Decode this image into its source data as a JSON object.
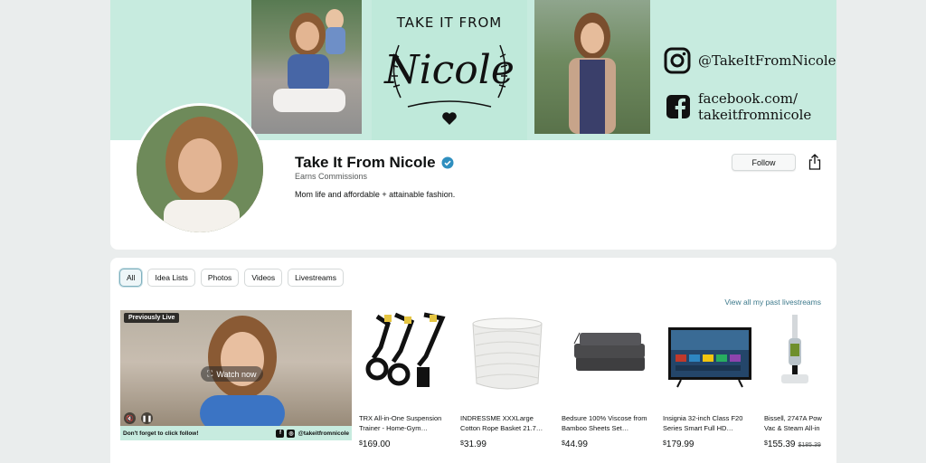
{
  "profile": {
    "name": "Take It From Nicole",
    "earns": "Earns Commissions",
    "bio": "Mom life and affordable + attainable fashion.",
    "follow_label": "Follow",
    "banner": {
      "logo_top_text": "TAKE IT FROM",
      "logo_script_text": "Nicole",
      "instagram_handle": "@TakeItFromNicole",
      "facebook_line1": "facebook.com/",
      "facebook_line2": "takeitfromnicole",
      "bg_color": "#c7ebdf"
    }
  },
  "filters": [
    {
      "label": "All",
      "active": true
    },
    {
      "label": "Idea Lists",
      "active": false
    },
    {
      "label": "Photos",
      "active": false
    },
    {
      "label": "Videos",
      "active": false
    },
    {
      "label": "Livestreams",
      "active": false
    }
  ],
  "view_all_label": "View all my past livestreams",
  "livestream": {
    "badge": "Previously Live",
    "watch_label": "Watch now",
    "cta_text": "Don't forget to click follow!",
    "handle": "@takeitfromnicole"
  },
  "products": [
    {
      "title": "TRX All-in-One Suspension Trainer - Home-Gym…",
      "price_symbol": "$",
      "price": "169.00",
      "was": ""
    },
    {
      "title": "INDRESSME XXXLarge Cotton Rope Basket 21.7…",
      "price_symbol": "$",
      "price": "31.99",
      "was": ""
    },
    {
      "title": "Bedsure 100% Viscose from Bamboo Sheets Set…",
      "price_symbol": "$",
      "price": "44.99",
      "was": ""
    },
    {
      "title": "Insignia 32-inch Class F20 Series Smart Full HD…",
      "price_symbol": "$",
      "price": "179.99",
      "was": ""
    },
    {
      "title": "Bissell, 2747A Pow Vac & Steam All-in",
      "price_symbol": "$",
      "price": "155.39",
      "was": "$185.39"
    }
  ],
  "colors": {
    "accent": "#3e7a8c",
    "verified": "#2f8fbf",
    "mint": "#c7ebdf"
  }
}
